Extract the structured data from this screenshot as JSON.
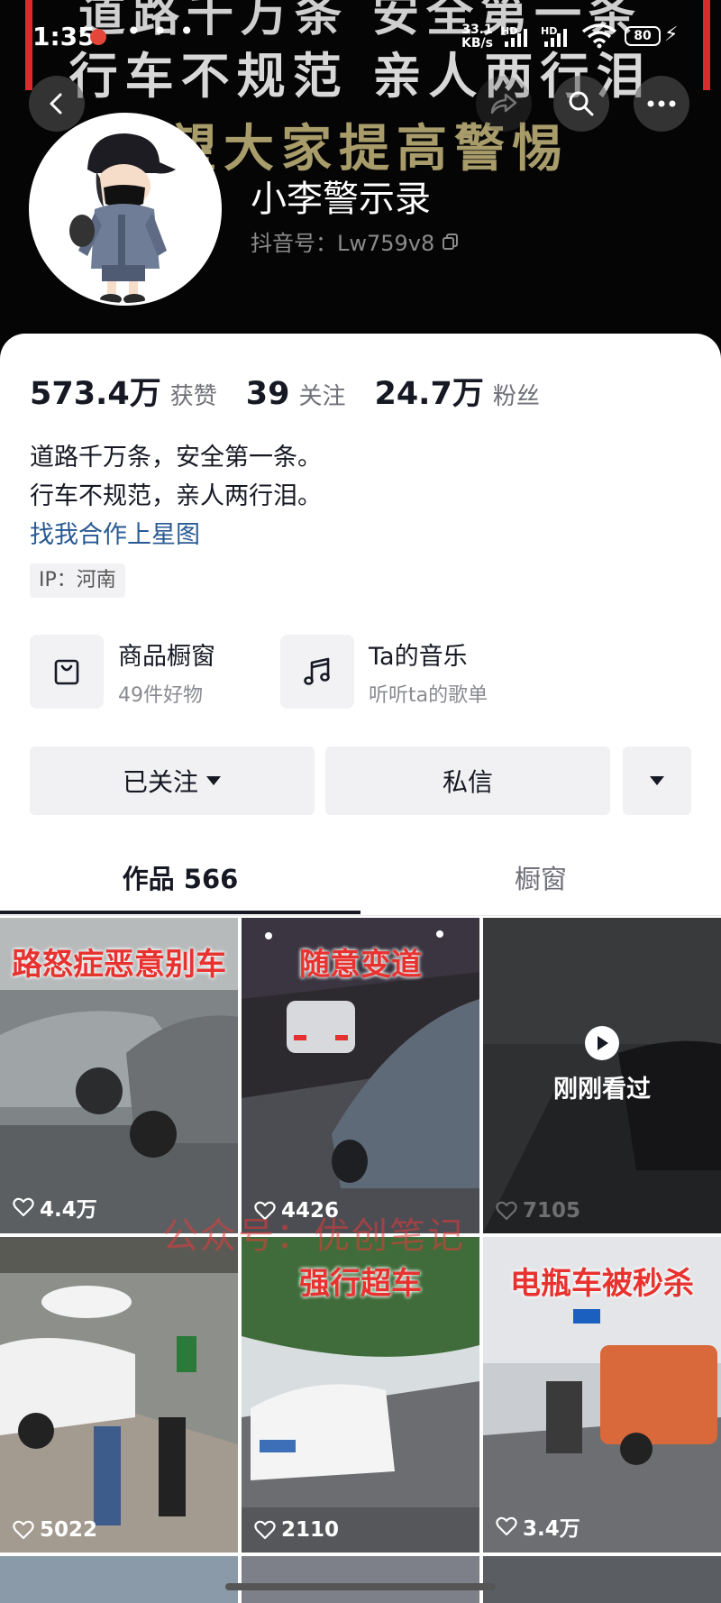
{
  "status_bar": {
    "time": "1:35",
    "net_speed_value": "33.1",
    "net_speed_unit": "KB/s",
    "hd_label": "HD",
    "battery": "80"
  },
  "banner": {
    "line1": "道路千万条  安全第一条",
    "line2": "行车不规范  亲人两行泪",
    "line3": "希望大家提高警惕"
  },
  "profile": {
    "name": "小李警示录",
    "douyin_id": "抖音号：Lw759v8"
  },
  "stats": {
    "likes_value": "573.4万",
    "likes_label": "获赞",
    "following_value": "39",
    "following_label": "关注",
    "followers_value": "24.7万",
    "followers_label": "粉丝"
  },
  "bio": {
    "line1": "道路千万条，安全第一条。",
    "line2": "行车不规范，亲人两行泪。",
    "link": "找我合作上星图",
    "ip": "IP：河南"
  },
  "features": {
    "shop_title": "商品橱窗",
    "shop_sub": "49件好物",
    "music_title": "Ta的音乐",
    "music_sub": "听听ta的歌单"
  },
  "actions": {
    "followed_label": "已关注",
    "message_label": "私信"
  },
  "tabs": {
    "works_label": "作品 566",
    "showcase_label": "橱窗"
  },
  "videos": [
    {
      "caption": "路怒症恶意别车",
      "likes": "4.4万"
    },
    {
      "caption": "随意变道",
      "likes": "4426"
    },
    {
      "caption": "",
      "likes": "7105",
      "overlay": "刚刚看过"
    },
    {
      "caption": "",
      "likes": "5022"
    },
    {
      "caption": "强行超车",
      "likes": "2110"
    },
    {
      "caption": "电瓶车被秒杀",
      "likes": "3.4万"
    }
  ],
  "watermark": "公众号：优创笔记",
  "colors": {
    "accent_link": "#2a5a93",
    "caption_red": "#e8322f",
    "banner_bg": "#050505"
  },
  "icons": [
    "back-icon",
    "share-icon",
    "search-icon",
    "more-icon",
    "copy-icon",
    "shopping-bag-icon",
    "music-note-icon",
    "caret-down-icon",
    "heart-icon",
    "play-icon"
  ]
}
